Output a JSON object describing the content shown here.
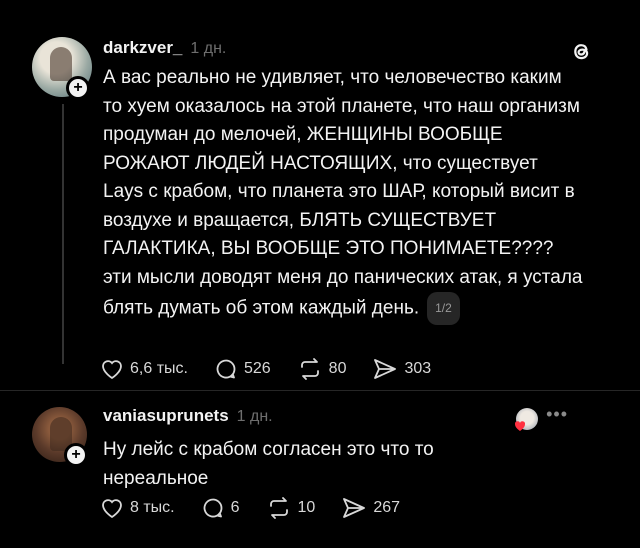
{
  "posts": [
    {
      "username": "darkzver_",
      "time": "1 дн.",
      "text": "А вас реально не удивляет, что человечество каким то хуем оказалось на этой планете, что наш организм продуман до мелочей, ЖЕНЩИНЫ ВООБЩЕ РОЖАЮТ ЛЮДЕЙ НАСТОЯЩИХ, что существует Lays с крабом, что планета это ШАР, который висит в воздухе и вращается, БЛЯТЬ СУЩЕСТВУЕТ ГАЛАКТИКА, ВЫ ВООБЩЕ ЭТО ПОНИМАЕТЕ???? эти мысли доводят меня до панических атак, я устала блять думать об этом каждый день.",
      "pager": "1/2",
      "likes": "6,6 тыс.",
      "replies": "526",
      "reposts": "80",
      "shares": "303"
    },
    {
      "username": "vaniasuprunets",
      "time": "1 дн.",
      "text": "Ну лейс с крабом согласен это что то нереальное",
      "likes": "8 тыс.",
      "replies": "6",
      "reposts": "10",
      "shares": "267"
    }
  ],
  "more_label": "•••",
  "plus_label": "+",
  "icons": {
    "logo": "threads-logo-icon",
    "like": "heart-icon",
    "reply": "comment-icon",
    "repost": "repost-icon",
    "share": "send-icon"
  },
  "colors": {
    "background": "#000000",
    "text": "#f3f3f3",
    "muted": "#6e6e6e",
    "heart": "#ff3040"
  }
}
